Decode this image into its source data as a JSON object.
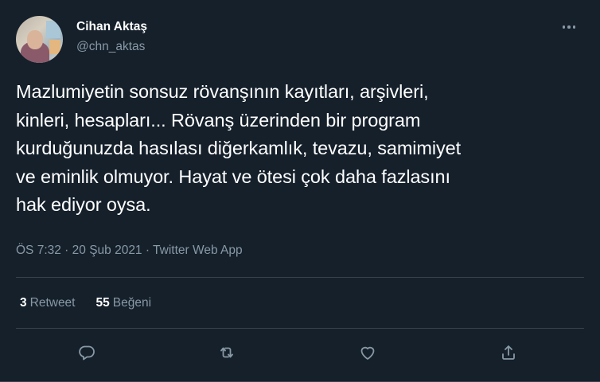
{
  "author": {
    "name": "Cihan Aktaş",
    "handle": "@chn_aktas"
  },
  "tweet": {
    "lines": [
      "Mazlumiyetin sonsuz rövanşının kayıtları, arşivleri,",
      "kinleri, hesapları... Rövanş üzerinden bir program",
      "kurduğunuzda hasılası diğerkamlık, tevazu, samimiyet",
      "ve eminlik olmuyor. Hayat ve ötesi çok daha fazlasını",
      "hak ediyor oysa."
    ],
    "meta": "ÖS 7:32 · 20 Şub 2021 · Twitter Web App"
  },
  "stats": {
    "retweets_count": "3",
    "retweets_label": "Retweet",
    "likes_count": "55",
    "likes_label": "Beğeni"
  },
  "icons": {
    "more": "more-horizontal-icon",
    "reply": "reply-icon",
    "retweet": "retweet-icon",
    "like": "heart-icon",
    "share": "share-icon"
  },
  "colors": {
    "background": "#15202b",
    "secondary_text": "#8899a6",
    "divider": "#38444d"
  }
}
